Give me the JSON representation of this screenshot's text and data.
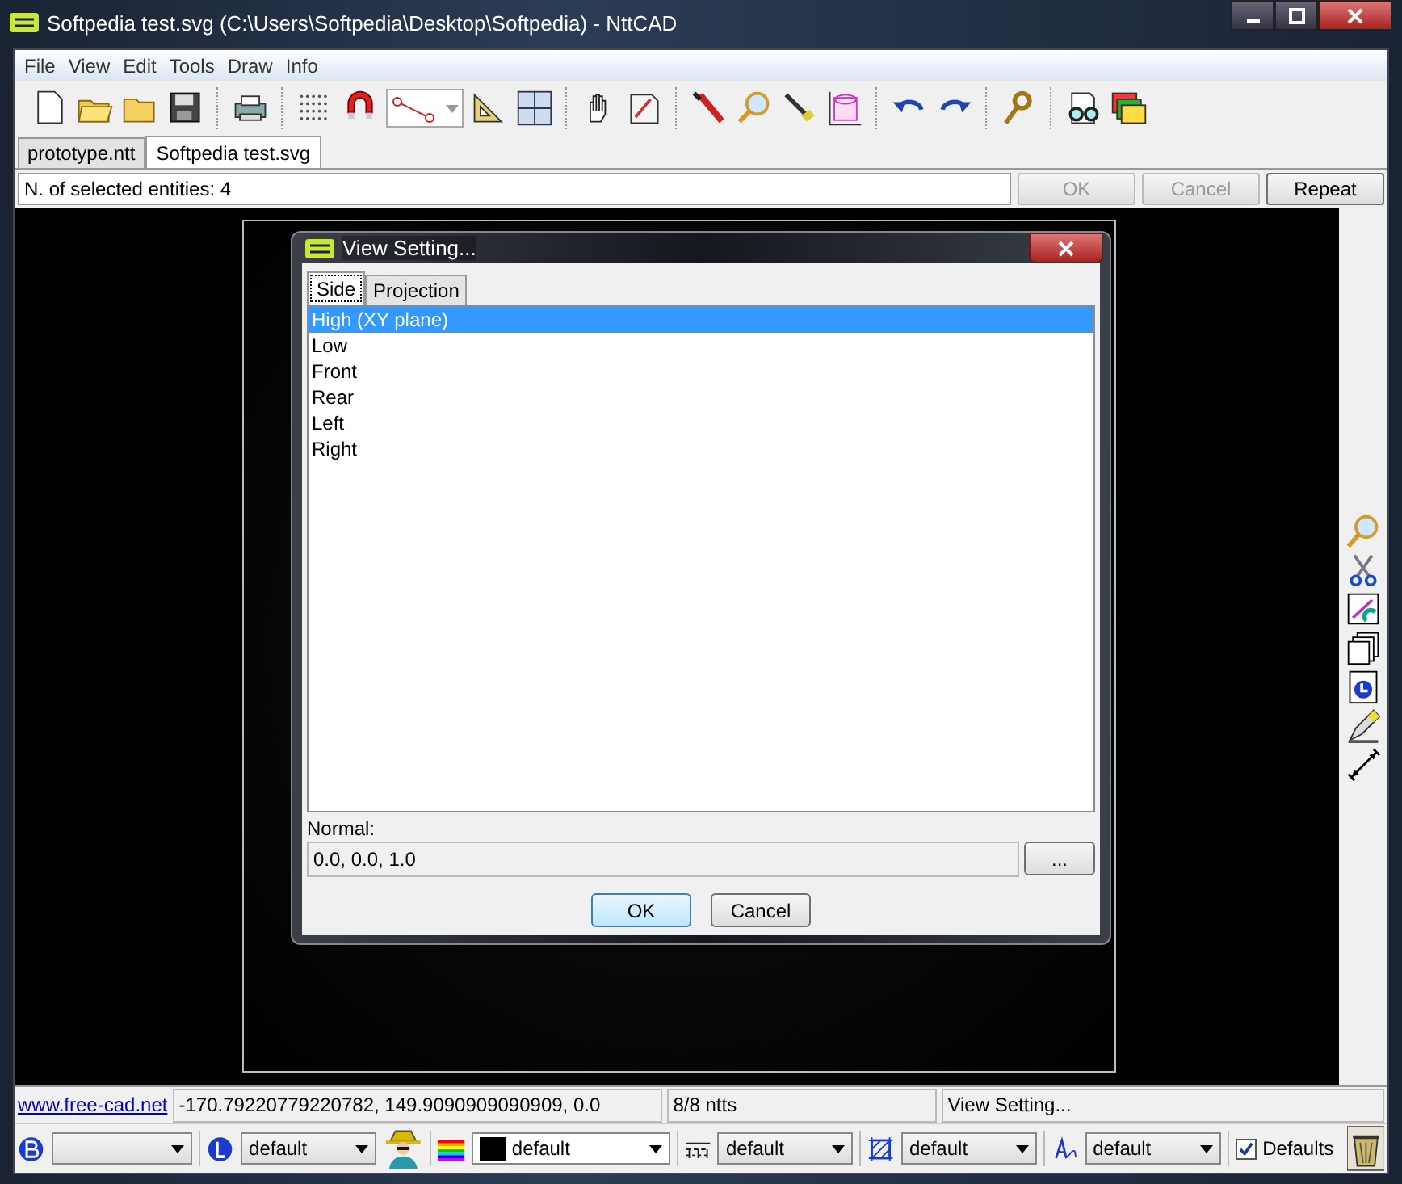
{
  "window": {
    "title": "Softpedia test.svg (C:\\Users\\Softpedia\\Desktop\\Softpedia) - NttCAD"
  },
  "menu": [
    "File",
    "View",
    "Edit",
    "Tools",
    "Draw",
    "Info"
  ],
  "tabs": [
    {
      "label": "prototype.ntt",
      "selected": false
    },
    {
      "label": "Softpedia test.svg",
      "selected": true
    }
  ],
  "command": {
    "text": "N. of selected entities: 4",
    "buttons": [
      {
        "label": "OK",
        "disabled": true
      },
      {
        "label": "Cancel",
        "disabled": true
      },
      {
        "label": "Repeat",
        "disabled": false
      }
    ]
  },
  "dialog": {
    "title": "View Setting...",
    "tabs": [
      {
        "label": "Side",
        "selected": true
      },
      {
        "label": "Projection",
        "selected": false
      }
    ],
    "items": [
      {
        "label": "High (XY plane)",
        "selected": true
      },
      {
        "label": "Low",
        "selected": false
      },
      {
        "label": "Front",
        "selected": false
      },
      {
        "label": "Rear",
        "selected": false
      },
      {
        "label": "Left",
        "selected": false
      },
      {
        "label": "Right",
        "selected": false
      }
    ],
    "normal_label": "Normal:",
    "normal_value": "0.0, 0.0, 1.0",
    "browse_button": "...",
    "buttons": [
      "OK",
      "Cancel"
    ]
  },
  "status_bar": {
    "link": "www.free-cad.net",
    "coordinates": "-170.79220779220782, 149.9090909090909, 0.0",
    "count": "8/8 ntts",
    "message": "View Setting..."
  },
  "bottom_bar": {
    "selectors": [
      {
        "kind": "b"
      },
      {
        "kind": "l",
        "value": "default"
      },
      {
        "kind": "color",
        "value": "default"
      },
      {
        "kind": "linetype",
        "value": "default"
      },
      {
        "kind": "hatch",
        "value": "default"
      },
      {
        "kind": "font",
        "value": "default"
      }
    ],
    "defaults": {
      "label": "Defaults",
      "checked": true
    }
  }
}
